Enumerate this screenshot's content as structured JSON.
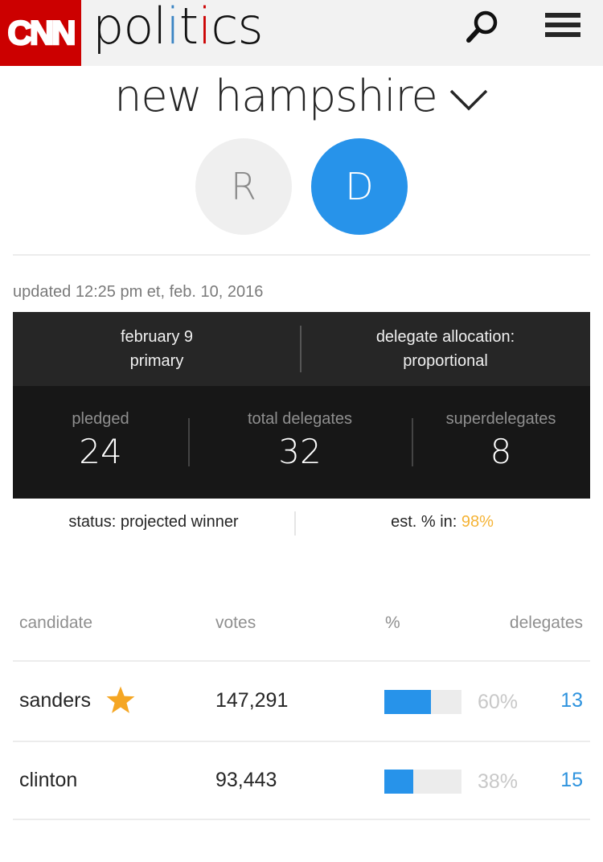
{
  "header": {
    "logo_text": "CNN",
    "brand": {
      "p1": "pol",
      "p2": "i",
      "p3": "t",
      "p4": "i",
      "p5": "cs"
    },
    "search_icon": "search-icon",
    "menu_icon": "hamburger-menu-icon"
  },
  "state_selector": {
    "label": "new hampshire",
    "icon": "chevron-down-icon"
  },
  "party_toggle": {
    "republican": "R",
    "democrat": "D",
    "selected": "D"
  },
  "updated": "updated 12:25 pm et, feb. 10, 2016",
  "contest_info": {
    "date_line1": "february 9",
    "date_line2": "primary",
    "allocation_line1": "delegate allocation:",
    "allocation_line2": "proportional"
  },
  "delegate_stats": [
    {
      "label": "pledged",
      "value": "24"
    },
    {
      "label": "total delegates",
      "value": "32"
    },
    {
      "label": "superdelegates",
      "value": "8"
    }
  ],
  "status": {
    "status_text": "status: projected winner",
    "est_label": "est. % in: ",
    "est_value": "98%"
  },
  "results_table": {
    "headers": {
      "candidate": "candidate",
      "votes": "votes",
      "percent": "%",
      "delegates": "delegates"
    },
    "rows": [
      {
        "candidate": "sanders",
        "winner": true,
        "votes": "147,291",
        "percent": "60%",
        "percent_value": 60,
        "delegates": "13"
      },
      {
        "candidate": "clinton",
        "winner": false,
        "votes": "93,443",
        "percent": "38%",
        "percent_value": 38,
        "delegates": "15"
      }
    ]
  },
  "colors": {
    "cnn_red": "#cc0000",
    "democrat_blue": "#2793ea",
    "republican_gray": "#efefef",
    "winner_star": "#f5a623",
    "est_highlight": "#f5b335",
    "delegates_link": "#2e93de"
  }
}
